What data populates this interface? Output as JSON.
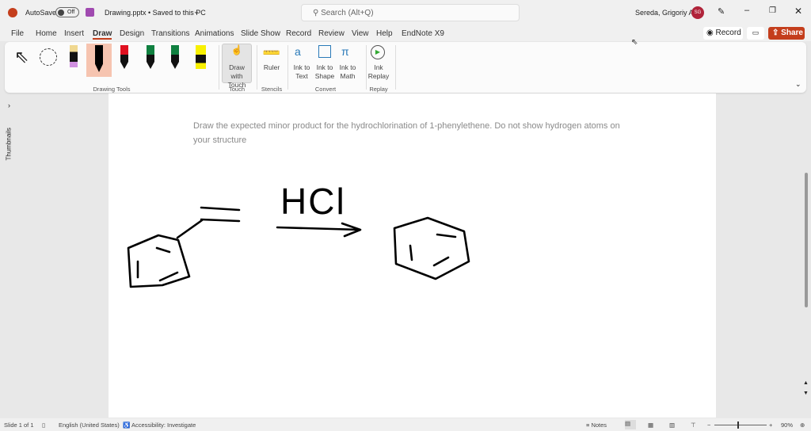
{
  "titlebar": {
    "autosave_label": "AutoSave",
    "autosave_state": "Off",
    "file_name": "Drawing.pptx • Saved to this PC",
    "search_placeholder": "Search (Alt+Q)",
    "user_name": "Sereda, Grigoriy A",
    "user_initials": "SG"
  },
  "menu": {
    "tabs": [
      "File",
      "Home",
      "Insert",
      "Draw",
      "Design",
      "Transitions",
      "Animations",
      "Slide Show",
      "Record",
      "Review",
      "View",
      "Help",
      "EndNote X9"
    ],
    "active": "Draw",
    "record_label": "Record",
    "share_label": "Share"
  },
  "ribbon": {
    "groups": {
      "drawing_tools": "Drawing Tools",
      "touch": "Touch",
      "stencils": "Stencils",
      "convert": "Convert",
      "replay": "Replay"
    },
    "buttons": {
      "draw_with_touch": "Draw with Touch",
      "ruler": "Ruler",
      "ink_to_text": "Ink to Text",
      "ink_to_shape": "Ink to Shape",
      "ink_to_math": "Ink to Math",
      "ink_replay": "Ink Replay"
    },
    "pen_colors": [
      "#f0d890",
      "#000000",
      "#e01020",
      "#108040",
      "#108040",
      "#f8f000"
    ]
  },
  "sidebar": {
    "thumbnails_label": "Thumbnails"
  },
  "slide": {
    "question": "Draw the expected minor product for the hydrochlorination of 1-phenylethene. Do not show hydrogen atoms on your structure",
    "reagent": "HCl"
  },
  "status": {
    "slide_info": "Slide 1 of 1",
    "language": "English (United States)",
    "accessibility": "Accessibility: Investigate",
    "notes": "Notes",
    "zoom": "90%"
  },
  "colors": {
    "accent": "#c43e1c",
    "avatar": "#b0233a"
  }
}
